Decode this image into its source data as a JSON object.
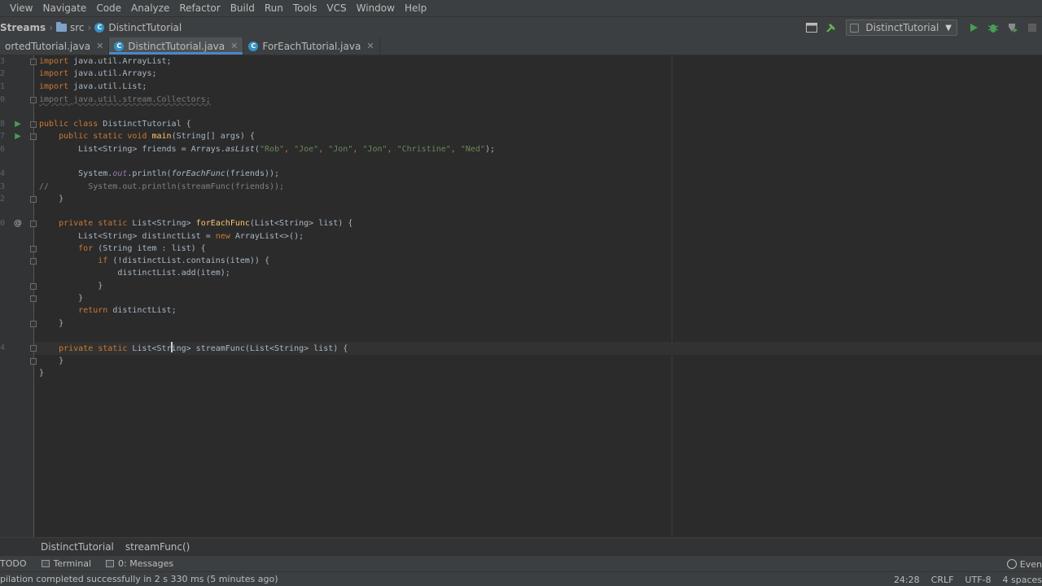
{
  "menu": {
    "items": [
      "View",
      "Navigate",
      "Code",
      "Analyze",
      "Refactor",
      "Build",
      "Run",
      "Tools",
      "VCS",
      "Window",
      "Help"
    ]
  },
  "navbar": {
    "project": "Streams",
    "folder": "src",
    "file": "DistinctTutorial",
    "run_config": "DistinctTutorial"
  },
  "tabs": [
    {
      "label": "ortedTutorial.java",
      "active": false
    },
    {
      "label": "DistinctTutorial.java",
      "active": true
    },
    {
      "label": "ForEachTutorial.java",
      "active": false
    }
  ],
  "gutter": {
    "line_numbers": [
      "3",
      "2",
      "1",
      "0",
      "",
      "8",
      "7",
      "6",
      "",
      "4",
      "3",
      "2",
      "",
      "0",
      "",
      "",
      "",
      "",
      "",
      "",
      "",
      "",
      "4",
      "",
      ""
    ],
    "run_mark": "▶",
    "override_mark": "@"
  },
  "code": {
    "l0": [
      "import",
      " java.util.ArrayList;"
    ],
    "l1": [
      "import",
      " java.util.Arrays;"
    ],
    "l2": [
      "import",
      " java.util.List;"
    ],
    "l3": "import java.util.stream.Collectors;",
    "l5": [
      "public class",
      " DistinctTutorial {"
    ],
    "l6": [
      "    public static void ",
      "main",
      "(String[] args) {"
    ],
    "l7": [
      "        List<String> friends = Arrays.",
      "asList",
      "(",
      "\"Rob\"",
      ", ",
      "\"Joe\"",
      ", ",
      "\"Jon\"",
      ", ",
      "\"Jon\"",
      ", ",
      "\"Christine\"",
      ", ",
      "\"Ned\"",
      ");"
    ],
    "l9": [
      "        System.",
      "out",
      ".println(",
      "forEachFunc",
      "(friends));"
    ],
    "l10": "//        System.out.println(streamFunc(friends));",
    "l11": "    }",
    "l13": [
      "    private static ",
      "List<String> ",
      "forEachFunc",
      "(List<String> list) {"
    ],
    "l14": [
      "        List<String> distinctList = ",
      "new",
      " ArrayList<>();"
    ],
    "l15": [
      "        for",
      " (String item : list) {"
    ],
    "l16": [
      "            if",
      " (!distinctList.contains(item)) {"
    ],
    "l17": "                distinctList.add(item);",
    "l18": "            }",
    "l19": "        }",
    "l20": [
      "        return",
      " distinctList;"
    ],
    "l21": "    }",
    "l23": [
      "    private static ",
      "List<Str",
      "ing> streamFunc(List<String> list) {"
    ],
    "l24": "    }",
    "l25": "}"
  },
  "breadcrumbs": [
    "DistinctTutorial",
    "streamFunc()"
  ],
  "toolwindows": {
    "todo": "TODO",
    "terminal": "Terminal",
    "messages": "0: Messages",
    "event": "Even"
  },
  "status": {
    "message": "pilation completed successfully in 2 s 330 ms (5 minutes ago)",
    "position": "24:28",
    "line_sep": "CRLF",
    "encoding": "UTF-8",
    "indent": "4 spaces"
  },
  "colors": {
    "editor_bg": "#2b2b2b",
    "keyword": "#cc7832",
    "method": "#ffc66d",
    "string": "#6a8759",
    "accent": "#4a88c7",
    "run_green": "#499c54"
  }
}
